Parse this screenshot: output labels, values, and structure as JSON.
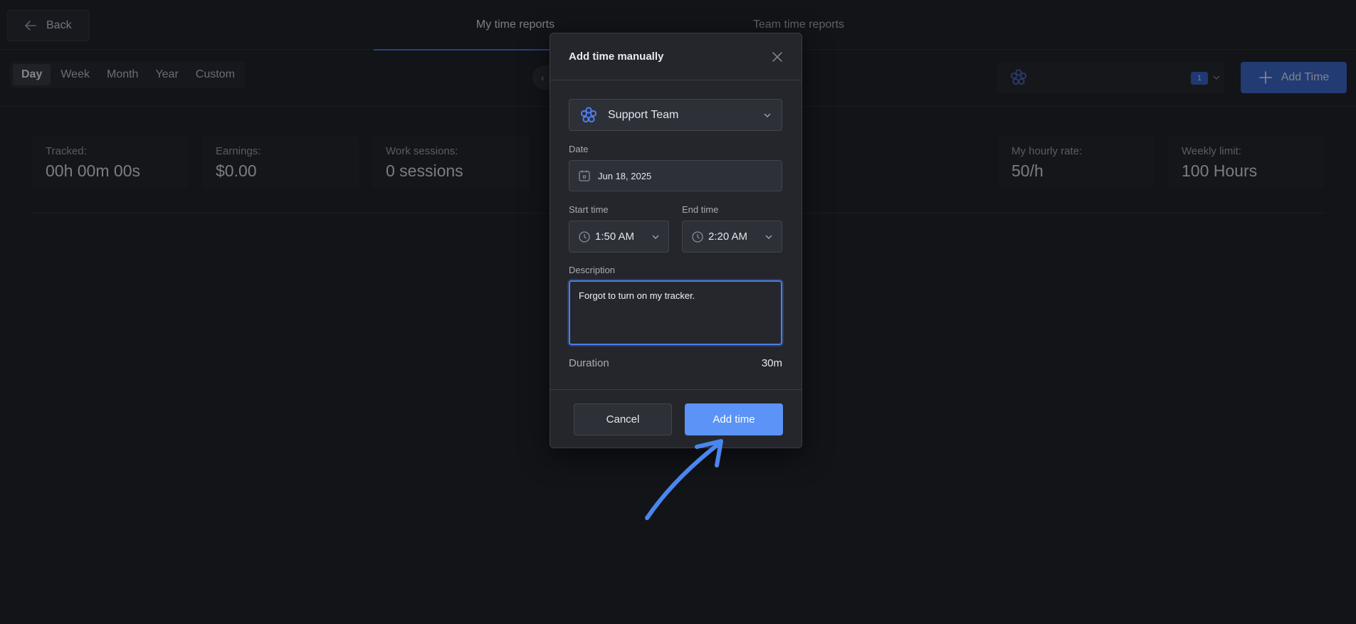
{
  "header": {
    "back_label": "Back",
    "tabs": [
      {
        "label": "My time reports",
        "active": true
      },
      {
        "label": "Team time reports",
        "active": false
      }
    ]
  },
  "toolbar": {
    "periods": [
      "Day",
      "Week",
      "Month",
      "Year",
      "Custom"
    ],
    "active_period": "Day",
    "team_badge": "1",
    "add_time_label": "Add Time"
  },
  "stats": [
    {
      "label": "Tracked:",
      "value": "00h 00m 00s"
    },
    {
      "label": "Earnings:",
      "value": "$0.00"
    },
    {
      "label": "Work sessions:",
      "value": "0 sessions"
    },
    {
      "label": "My hourly rate:",
      "value": "50/h"
    },
    {
      "label": "Weekly limit:",
      "value": "100 Hours"
    }
  ],
  "modal": {
    "title": "Add time manually",
    "team": "Support Team",
    "date_label": "Date",
    "date_value": "Jun 18, 2025",
    "start_label": "Start time",
    "start_value": "1:50 AM",
    "end_label": "End time",
    "end_value": "2:20 AM",
    "description_label": "Description",
    "description_value": "Forgot to turn on my tracker.",
    "duration_label": "Duration",
    "duration_value": "30m",
    "cancel_label": "Cancel",
    "submit_label": "Add time"
  },
  "colors": {
    "background": "#1b1c21",
    "accent": "#5b93f7",
    "annotation_arrow": "#4a86f0"
  }
}
